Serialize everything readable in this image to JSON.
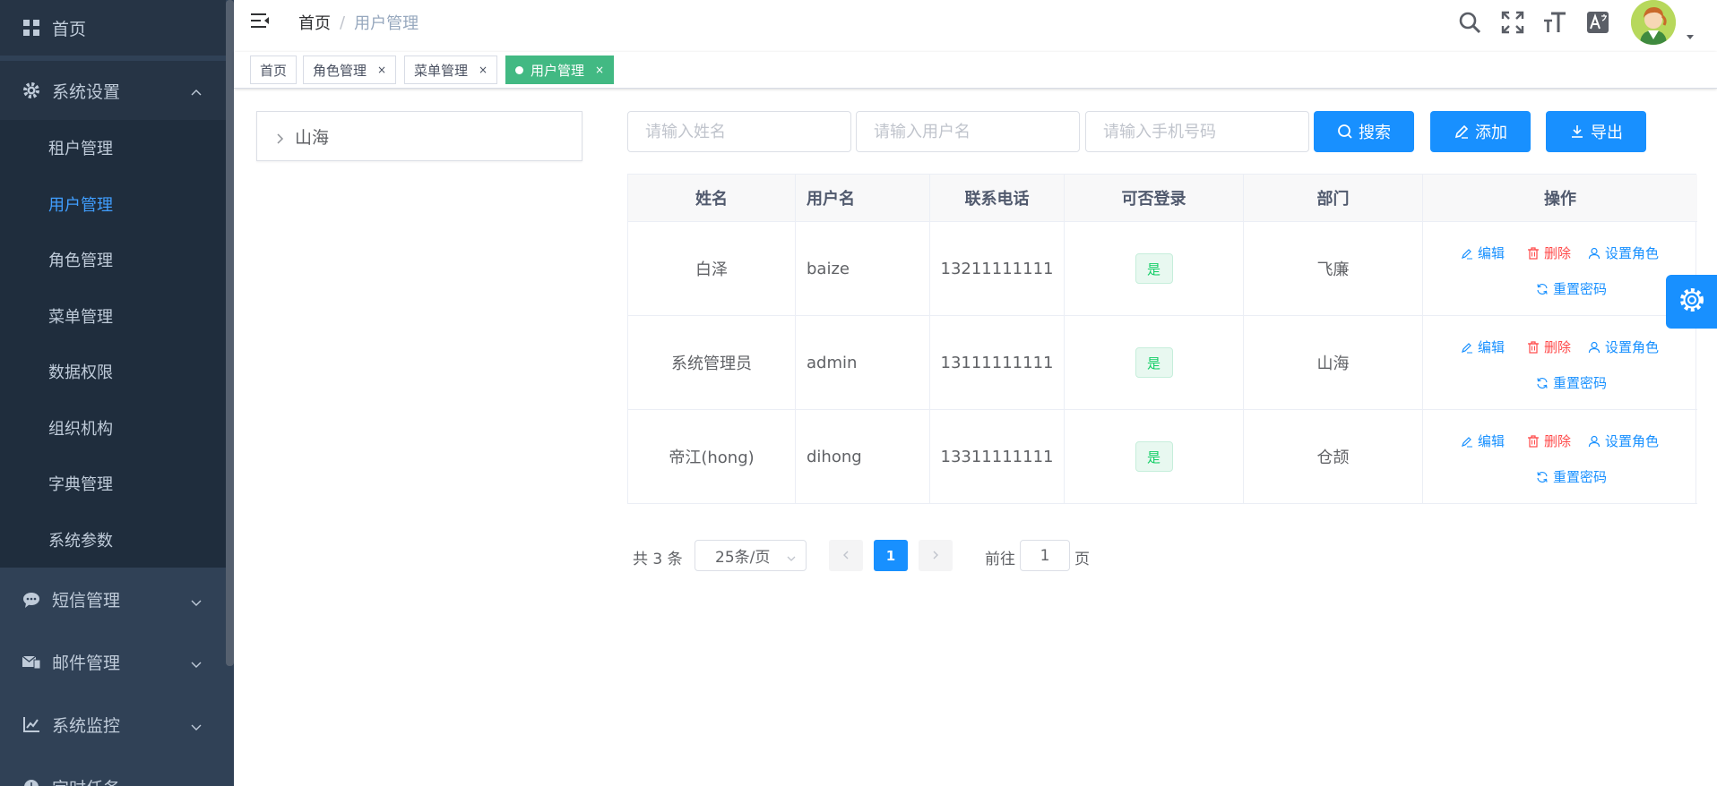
{
  "sidebar": {
    "home": "首页",
    "system_group": "系统设置",
    "sub_items": [
      {
        "label": "租户管理",
        "active": false
      },
      {
        "label": "用户管理",
        "active": true
      },
      {
        "label": "角色管理",
        "active": false
      },
      {
        "label": "菜单管理",
        "active": false
      },
      {
        "label": "数据权限",
        "active": false
      },
      {
        "label": "组织机构",
        "active": false
      },
      {
        "label": "字典管理",
        "active": false
      },
      {
        "label": "系统参数",
        "active": false
      }
    ],
    "groups": [
      {
        "label": "短信管理",
        "icon": "message-icon"
      },
      {
        "label": "邮件管理",
        "icon": "mail-icon"
      },
      {
        "label": "系统监控",
        "icon": "monitor-chart-icon"
      },
      {
        "label": "定时任务",
        "icon": "timer-icon"
      }
    ],
    "colors": {
      "bg": "#304156",
      "active_text": "#409eff",
      "text": "#bfcbd9"
    }
  },
  "navbar": {
    "breadcrumb": {
      "home": "首页",
      "separator": "/",
      "current": "用户管理"
    },
    "icons": [
      "search-icon",
      "fullscreen-icon",
      "font-size-icon",
      "translate-icon"
    ]
  },
  "tags": [
    {
      "label": "首页",
      "active": false,
      "closable": false
    },
    {
      "label": "角色管理",
      "active": false,
      "closable": true
    },
    {
      "label": "菜单管理",
      "active": false,
      "closable": true
    },
    {
      "label": "用户管理",
      "active": true,
      "closable": true
    }
  ],
  "tag_close": "×",
  "tree": {
    "root": "山海"
  },
  "search": {
    "name_placeholder": "请输入姓名",
    "username_placeholder": "请输入用户名",
    "phone_placeholder": "请输入手机号码",
    "search_label": "搜索",
    "add_label": "添加",
    "export_label": "导出"
  },
  "table": {
    "headers": [
      "姓名",
      "用户名",
      "联系电话",
      "可否登录",
      "部门",
      "操作"
    ],
    "rows": [
      {
        "name": "白泽",
        "username": "baize",
        "phone": "13211111111",
        "login": "是",
        "dept": "飞廉"
      },
      {
        "name": "系统管理员",
        "username": "admin",
        "phone": "13111111111",
        "login": "是",
        "dept": "山海"
      },
      {
        "name": "帝江(hong)",
        "username": "dihong",
        "phone": "13311111111",
        "login": "是",
        "dept": "仓颉"
      }
    ],
    "actions": {
      "edit": "编辑",
      "delete": "删除",
      "set_role": "设置角色",
      "reset_pwd": "重置密码"
    }
  },
  "pagination": {
    "total": "共 3 条",
    "page_size": "25条/页",
    "current": "1",
    "goto_prefix": "前往",
    "goto_value": "1",
    "goto_suffix": "页"
  },
  "colors": {
    "primary": "#1890ff",
    "success_tag": "#42b983",
    "danger": "#ff4949"
  }
}
